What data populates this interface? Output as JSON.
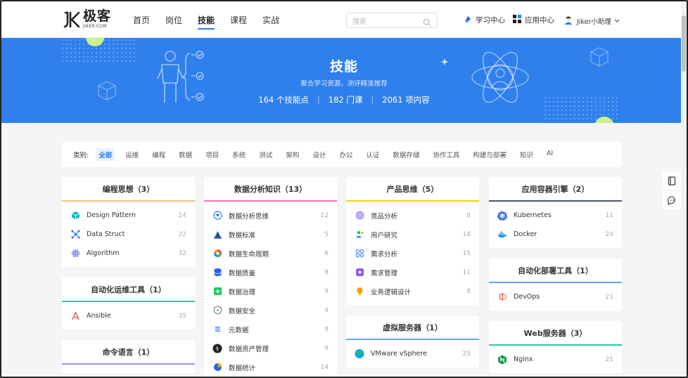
{
  "header": {
    "logo_cn": "极客",
    "logo_en": "JIKER.COM",
    "nav": [
      {
        "label": "首页"
      },
      {
        "label": "岗位"
      },
      {
        "label": "技能",
        "active": true
      },
      {
        "label": "课程"
      },
      {
        "label": "实战"
      }
    ],
    "search_placeholder": "搜索",
    "learning_center": "学习中心",
    "app_center": "应用中心",
    "user": "Jiker小助理"
  },
  "banner": {
    "title": "技能",
    "subtitle": "聚合学习资源，测评精准推荐",
    "stats": [
      "164 个技能点",
      "182 门课",
      "2061 项内容"
    ],
    "separator": "|"
  },
  "filter": {
    "label": "类别:",
    "categories": [
      "全部",
      "运维",
      "编程",
      "数据",
      "项目",
      "系统",
      "测试",
      "架构",
      "设计",
      "办公",
      "认证",
      "数据存储",
      "协作工具",
      "构建与部署",
      "知识",
      "AI"
    ],
    "active_index": 0
  },
  "cards": [
    {
      "id": "c1",
      "title": "编程思想（3）",
      "accent": "#f1c27d",
      "items": [
        {
          "name": "Design Pattern",
          "count": "24",
          "icon": "cube-icon",
          "color": "#1fb6c9"
        },
        {
          "name": "Data Struct",
          "count": "22",
          "icon": "network-icon",
          "color": "#2f80ed"
        },
        {
          "name": "Algorithm",
          "count": "32",
          "icon": "atom-icon",
          "color": "#6c7ae0"
        }
      ]
    },
    {
      "id": "c2",
      "title": "自动化运维工具（1）",
      "accent": "#2ec4a6",
      "items": [
        {
          "name": "Ansible",
          "count": "35",
          "icon": "ansible-icon",
          "color": "#e05c4b"
        }
      ]
    },
    {
      "id": "c3",
      "title": "命令语言（1）",
      "accent": "#a78bfa",
      "items": []
    },
    {
      "id": "c4",
      "title": "数据分析知识（13）",
      "accent": "#f472b6",
      "items": [
        {
          "name": "数据分析思维",
          "count": "12",
          "icon": "brain-icon",
          "color": "#2f80ed"
        },
        {
          "name": "数据标准",
          "count": "5",
          "icon": "standard-icon",
          "color": "#1f4fa3"
        },
        {
          "name": "数据生命周期",
          "count": "6",
          "icon": "cycle-icon",
          "color": "#f59e0b"
        },
        {
          "name": "数据质量",
          "count": "8",
          "icon": "database-icon",
          "color": "#2563eb"
        },
        {
          "name": "数据治理",
          "count": "9",
          "icon": "governance-icon",
          "color": "#22c55e"
        },
        {
          "name": "数据安全",
          "count": "4",
          "icon": "shield-icon",
          "color": "#64748b"
        },
        {
          "name": "元数据",
          "count": "9",
          "icon": "metadata-icon",
          "color": "#3b82f6"
        },
        {
          "name": "数据资产管理",
          "count": "9",
          "icon": "asset-icon",
          "color": "#222222"
        },
        {
          "name": "数据统计",
          "count": "14",
          "icon": "pie-chart-icon",
          "color": "#2563eb"
        }
      ]
    },
    {
      "id": "c5",
      "title": "产品思维（5）",
      "accent": "#facc15",
      "items": [
        {
          "name": "竞品分析",
          "count": "8",
          "icon": "target-icon",
          "color": "#8b5cf6"
        },
        {
          "name": "用户研究",
          "count": "18",
          "icon": "user-research-icon",
          "color": "#10b981"
        },
        {
          "name": "需求分析",
          "count": "15",
          "icon": "grid-icon",
          "color": "#3b82f6"
        },
        {
          "name": "需求管理",
          "count": "11",
          "icon": "tag-icon",
          "color": "#8b5cf6"
        },
        {
          "name": "业务逻辑设计",
          "count": "8",
          "icon": "bulb-icon",
          "color": "#f59e0b"
        }
      ]
    },
    {
      "id": "c6",
      "title": "虚拟服务器（1）",
      "accent": "#60a5fa",
      "items": [
        {
          "name": "VMware vSphere",
          "count": "25",
          "icon": "globe-icon",
          "color": "#0ea5e9"
        }
      ]
    },
    {
      "id": "c7",
      "title": "应用容器引擎（2）",
      "accent": "#4b5563",
      "items": [
        {
          "name": "Kubernetes",
          "count": "11",
          "icon": "kubernetes-icon",
          "color": "#326ce5"
        },
        {
          "name": "Docker",
          "count": "24",
          "icon": "docker-icon",
          "color": "#2496ed"
        }
      ]
    },
    {
      "id": "c8",
      "title": "自动化部署工具（1）",
      "accent": "#60a5fa",
      "items": [
        {
          "name": "DevOps",
          "count": "21",
          "icon": "devops-icon",
          "color": "#ef4444"
        }
      ]
    },
    {
      "id": "c9",
      "title": "Web服务器（3）",
      "accent": "#2ec4a6",
      "items": [
        {
          "name": "Nginx",
          "count": "21",
          "icon": "nginx-icon",
          "color": "#009639"
        }
      ]
    }
  ],
  "colors": {
    "primary": "#2f80ed",
    "banner": "#2f80ed"
  }
}
